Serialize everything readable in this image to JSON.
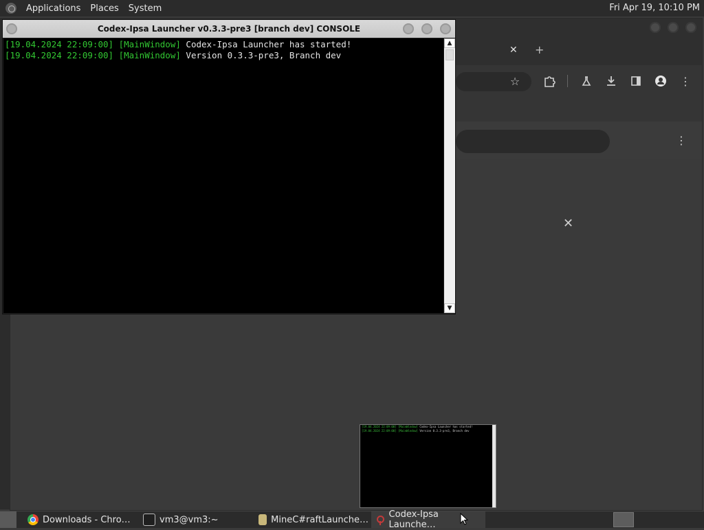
{
  "top_panel": {
    "menus": [
      "Applications",
      "Places",
      "System"
    ],
    "clock": "Fri Apr 19, 10:10 PM"
  },
  "browser_bg": {
    "tab_close_glyph": "✕",
    "tab_add_glyph": "+",
    "toolbar_icons": [
      "star-icon",
      "extensions-icon",
      "labs-icon",
      "download-icon",
      "sidepanel-icon",
      "profile-icon",
      "menu-icon"
    ],
    "content_close_glyph": "✕"
  },
  "console": {
    "title": "Codex-Ipsa Launcher v0.3.3-pre3 [branch dev] CONSOLE",
    "lines": [
      {
        "ts": "[19.04.2024 22:09:00]",
        "tag": "[MainWindow]",
        "msg": "Codex-Ipsa Launcher has started!"
      },
      {
        "ts": "[19.04.2024 22:09:00]",
        "tag": "[MainWindow]",
        "msg": "Version 0.3.3-pre3, Branch dev"
      }
    ],
    "scroll_up": "▲",
    "scroll_down": "▼"
  },
  "preview": {
    "lines": [
      {
        "ts": "[19.04.2024 22:09:00]",
        "tag": "[MainWindow]",
        "msg": "Codex-Ipsa Launcher has started!"
      },
      {
        "ts": "[19.04.2024 22:09:00]",
        "tag": "[MainWindow]",
        "msg": "Version 0.3.3-pre3, Branch dev"
      }
    ]
  },
  "taskbar": {
    "items": [
      {
        "label": "Downloads - Chro…",
        "icon": "chrome-icon"
      },
      {
        "label": "vm3@vm3:~",
        "icon": "terminal-icon"
      },
      {
        "label": "MineC#raftLaunche…",
        "icon": "folder-icon"
      },
      {
        "label": "Codex-Ipsa Launche…",
        "icon": "launcher-icon",
        "active": true
      }
    ]
  }
}
